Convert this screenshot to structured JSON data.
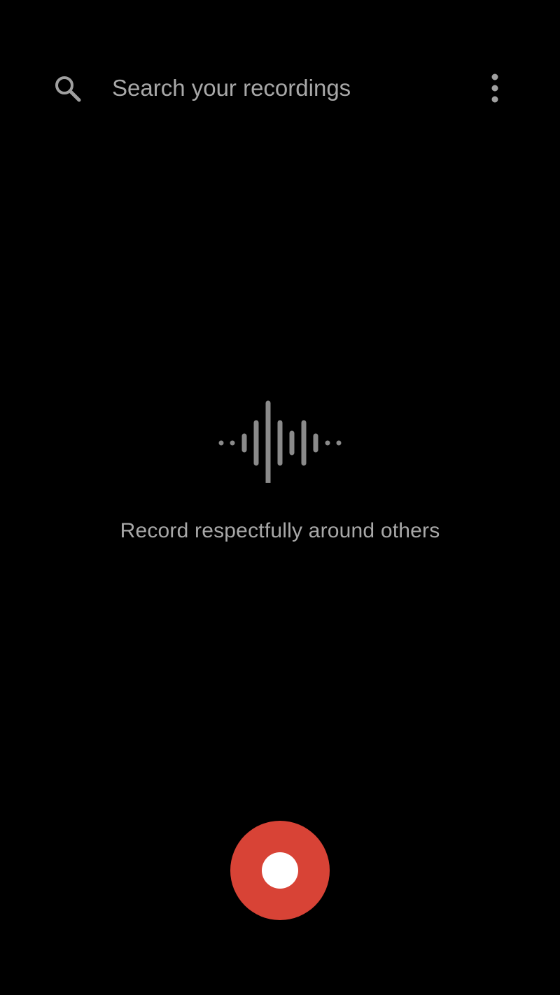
{
  "search": {
    "placeholder": "Search your recordings",
    "icon": "search-icon"
  },
  "menu": {
    "icon": "more-vert-icon"
  },
  "empty_state": {
    "icon": "waveform-icon",
    "message": "Record respectfully around others"
  },
  "record": {
    "icon": "record-icon",
    "color": "#d84336"
  },
  "colors": {
    "background": "#000000",
    "text_secondary": "#a8a8a8",
    "icon": "#9e9e9e",
    "waveform": "#8a8a8a",
    "accent": "#d84336"
  }
}
